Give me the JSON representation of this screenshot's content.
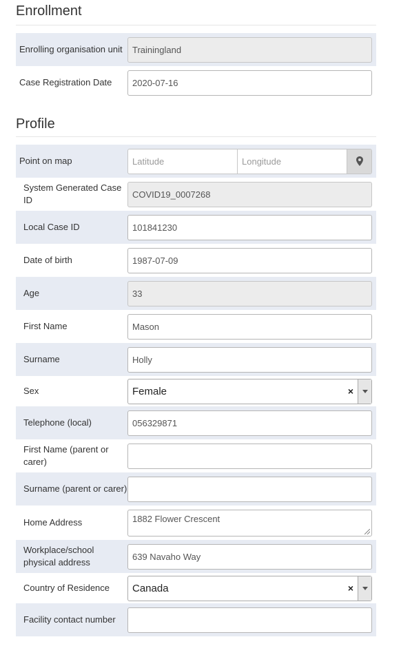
{
  "enrollment": {
    "title": "Enrollment",
    "fields": {
      "org_unit_label": "Enrolling organisation unit",
      "org_unit_value": "Trainingland",
      "reg_date_label": "Case Registration Date",
      "reg_date_value": "2020-07-16"
    }
  },
  "profile": {
    "title": "Profile",
    "point_on_map": {
      "label": "Point on map",
      "latitude_placeholder": "Latitude",
      "longitude_placeholder": "Longitude",
      "button_icon": "map-marker-icon"
    },
    "system_case_id": {
      "label": "System Generated Case ID",
      "value": "COVID19_0007268"
    },
    "local_case_id": {
      "label": "Local Case ID",
      "value": "101841230"
    },
    "dob": {
      "label": "Date of birth",
      "value": "1987-07-09"
    },
    "age": {
      "label": "Age",
      "value": "33"
    },
    "first_name": {
      "label": "First Name",
      "value": "Mason"
    },
    "surname": {
      "label": "Surname",
      "value": "Holly"
    },
    "sex": {
      "label": "Sex",
      "value": "Female",
      "clear": "×"
    },
    "telephone": {
      "label": "Telephone (local)",
      "value": "056329871"
    },
    "parent_first_name": {
      "label": "First Name (parent or carer)",
      "value": ""
    },
    "parent_surname": {
      "label": "Surname (parent or carer)",
      "value": ""
    },
    "home_address": {
      "label": "Home Address",
      "value": "1882 Flower Crescent"
    },
    "workplace_address": {
      "label": "Workplace/school physical address",
      "value": "639 Navaho Way"
    },
    "country": {
      "label": "Country of Residence",
      "value": "Canada",
      "clear": "×"
    },
    "facility_contact": {
      "label": "Facility contact number",
      "value": ""
    }
  },
  "colors": {
    "row_shade": "#e7ebf3",
    "disabled_field": "#ececec",
    "border": "#b5b5b5"
  }
}
